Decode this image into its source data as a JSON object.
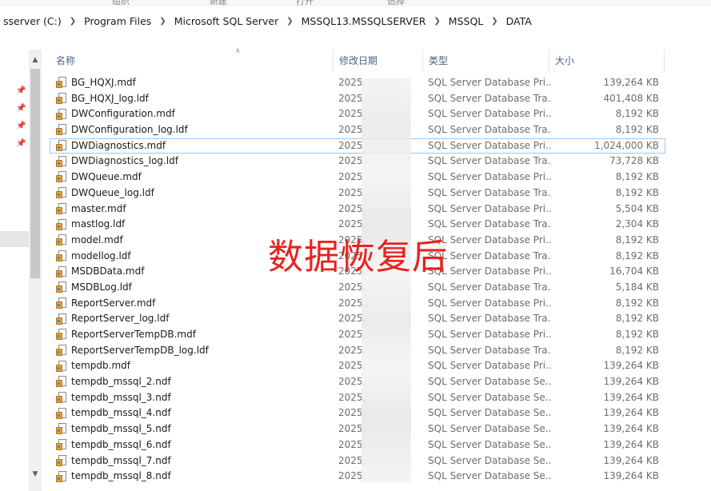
{
  "ribbon": {
    "groups": [
      "组织",
      "新建",
      "打开",
      "选择"
    ]
  },
  "address": {
    "crumbs": [
      "sserver (C:)",
      "Program Files",
      "Microsoft SQL Server",
      "MSSQL13.MSSQLSERVER",
      "MSSQL",
      "DATA"
    ]
  },
  "columns": {
    "name": "名称",
    "date": "修改日期",
    "type": "类型",
    "size": "大小"
  },
  "files": [
    {
      "name": "BG_HQXJ.mdf",
      "date": "2025,",
      "type": "SQL Server Database Pri...",
      "size": "139,264 KB"
    },
    {
      "name": "BG_HQXJ_log.ldf",
      "date": "2025,",
      "type": "SQL Server Database Tra...",
      "size": "401,408 KB"
    },
    {
      "name": "DWConfiguration.mdf",
      "date": "2025,",
      "type": "SQL Server Database Pri...",
      "size": "8,192 KB"
    },
    {
      "name": "DWConfiguration_log.ldf",
      "date": "2025,",
      "type": "SQL Server Database Tra...",
      "size": "8,192 KB"
    },
    {
      "name": "DWDiagnostics.mdf",
      "date": "2025,",
      "type": "SQL Server Database Pri...",
      "size": "1,024,000 KB"
    },
    {
      "name": "DWDiagnostics_log.ldf",
      "date": "2025,",
      "type": "SQL Server Database Tra...",
      "size": "73,728 KB"
    },
    {
      "name": "DWQueue.mdf",
      "date": "2025,",
      "type": "SQL Server Database Pri...",
      "size": "8,192 KB"
    },
    {
      "name": "DWQueue_log.ldf",
      "date": "2025,",
      "type": "SQL Server Database Tra...",
      "size": "8,192 KB"
    },
    {
      "name": "master.mdf",
      "date": "2025,",
      "type": "SQL Server Database Pri...",
      "size": "5,504 KB"
    },
    {
      "name": "mastlog.ldf",
      "date": "2025,",
      "type": "SQL Server Database Tra...",
      "size": "2,304 KB"
    },
    {
      "name": "model.mdf",
      "date": "2025,",
      "type": "SQL Server Database Pri...",
      "size": "8,192 KB"
    },
    {
      "name": "modellog.ldf",
      "date": "2025,",
      "type": "SQL Server Database Tra...",
      "size": "8,192 KB"
    },
    {
      "name": "MSDBData.mdf",
      "date": "2025,",
      "type": "SQL Server Database Pri...",
      "size": "16,704 KB"
    },
    {
      "name": "MSDBLog.ldf",
      "date": "2025,",
      "type": "SQL Server Database Tra...",
      "size": "5,184 KB"
    },
    {
      "name": "ReportServer.mdf",
      "date": "2025,",
      "type": "SQL Server Database Pri...",
      "size": "8,192 KB"
    },
    {
      "name": "ReportServer_log.ldf",
      "date": "2025,",
      "type": "SQL Server Database Tra...",
      "size": "8,192 KB"
    },
    {
      "name": "ReportServerTempDB.mdf",
      "date": "2025,",
      "type": "SQL Server Database Pri...",
      "size": "8,192 KB"
    },
    {
      "name": "ReportServerTempDB_log.ldf",
      "date": "2025,",
      "type": "SQL Server Database Tra...",
      "size": "8,192 KB"
    },
    {
      "name": "tempdb.mdf",
      "date": "2025,",
      "type": "SQL Server Database Pri...",
      "size": "139,264 KB"
    },
    {
      "name": "tempdb_mssql_2.ndf",
      "date": "2025,",
      "type": "SQL Server Database Se...",
      "size": "139,264 KB"
    },
    {
      "name": "tempdb_mssql_3.ndf",
      "date": "2025,",
      "type": "SQL Server Database Se...",
      "size": "139,264 KB"
    },
    {
      "name": "tempdb_mssql_4.ndf",
      "date": "2025,",
      "type": "SQL Server Database Se...",
      "size": "139,264 KB"
    },
    {
      "name": "tempdb_mssql_5.ndf",
      "date": "2025,",
      "type": "SQL Server Database Se...",
      "size": "139,264 KB"
    },
    {
      "name": "tempdb_mssql_6.ndf",
      "date": "2025,",
      "type": "SQL Server Database Se...",
      "size": "139,264 KB"
    },
    {
      "name": "tempdb_mssql_7.ndf",
      "date": "2025,",
      "type": "SQL Server Database Se...",
      "size": "139,264 KB"
    },
    {
      "name": "tempdb_mssql_8.ndf",
      "date": "2025,",
      "type": "SQL Server Database Se...",
      "size": "139,264 KB"
    }
  ],
  "selected_index": 4,
  "watermark": "数据恢复后",
  "icons": {
    "file": "sql-database-file-icon",
    "pin": "pin-icon",
    "sort": "sort-up-icon"
  },
  "colors": {
    "header_text": "#4d6185",
    "selection_border": "#99c9ef",
    "watermark": "#e8231f"
  }
}
